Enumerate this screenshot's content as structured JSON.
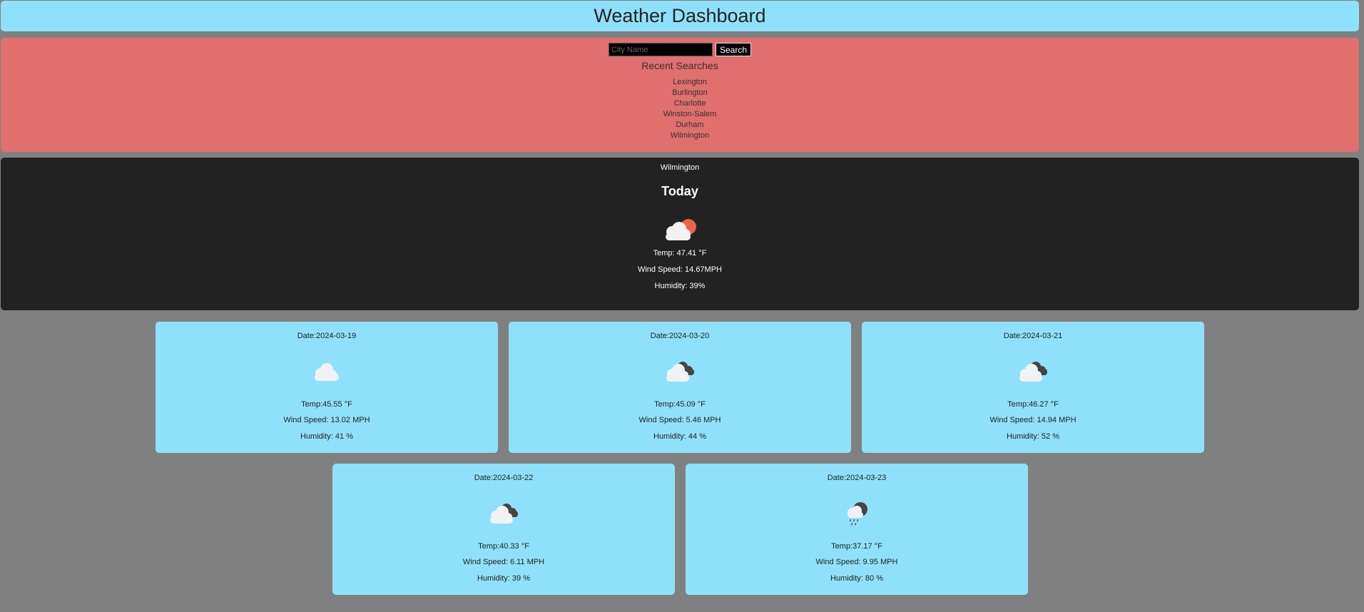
{
  "header": {
    "title": "Weather Dashboard"
  },
  "search": {
    "placeholder": "City Name",
    "button_label": "Search"
  },
  "recent": {
    "title": "Recent Searches",
    "items": [
      "Lexington",
      "Burlington",
      "Charlotte",
      "Winston-Salem",
      "Durham",
      "Wilmington"
    ]
  },
  "today": {
    "city": "Wilmington",
    "label": "Today",
    "icon": "cloud-with-sun-icon",
    "temp": "Temp: 47.41 °F",
    "wind": "Wind Speed: 14.67MPH",
    "humidity": "Humidity: 39%"
  },
  "forecast": [
    {
      "date": "Date:2024-03-19",
      "icon": "cloud-icon",
      "temp": "Temp:45.55 °F",
      "wind": "Wind Speed: 13.02 MPH",
      "humidity": "Humidity: 41 %"
    },
    {
      "date": "Date:2024-03-20",
      "icon": "broken-clouds-icon",
      "temp": "Temp:45.09 °F",
      "wind": "Wind Speed: 5.46 MPH",
      "humidity": "Humidity: 44 %"
    },
    {
      "date": "Date:2024-03-21",
      "icon": "broken-clouds-icon",
      "temp": "Temp:46.27 °F",
      "wind": "Wind Speed: 14.94 MPH",
      "humidity": "Humidity: 52 %"
    },
    {
      "date": "Date:2024-03-22",
      "icon": "broken-clouds-icon",
      "temp": "Temp:40.33 °F",
      "wind": "Wind Speed: 6.11 MPH",
      "humidity": "Humidity: 39 %"
    },
    {
      "date": "Date:2024-03-23",
      "icon": "rain-cloud-icon",
      "temp": "Temp:37.17 °F",
      "wind": "Wind Speed: 9.95 MPH",
      "humidity": "Humidity: 80 %"
    }
  ],
  "colors": {
    "background": "#808080",
    "header": "#8fe1fb",
    "search_panel": "#e06f6e",
    "today_panel": "#222222",
    "card": "#8fe1fb",
    "sun": "#e8654a"
  }
}
